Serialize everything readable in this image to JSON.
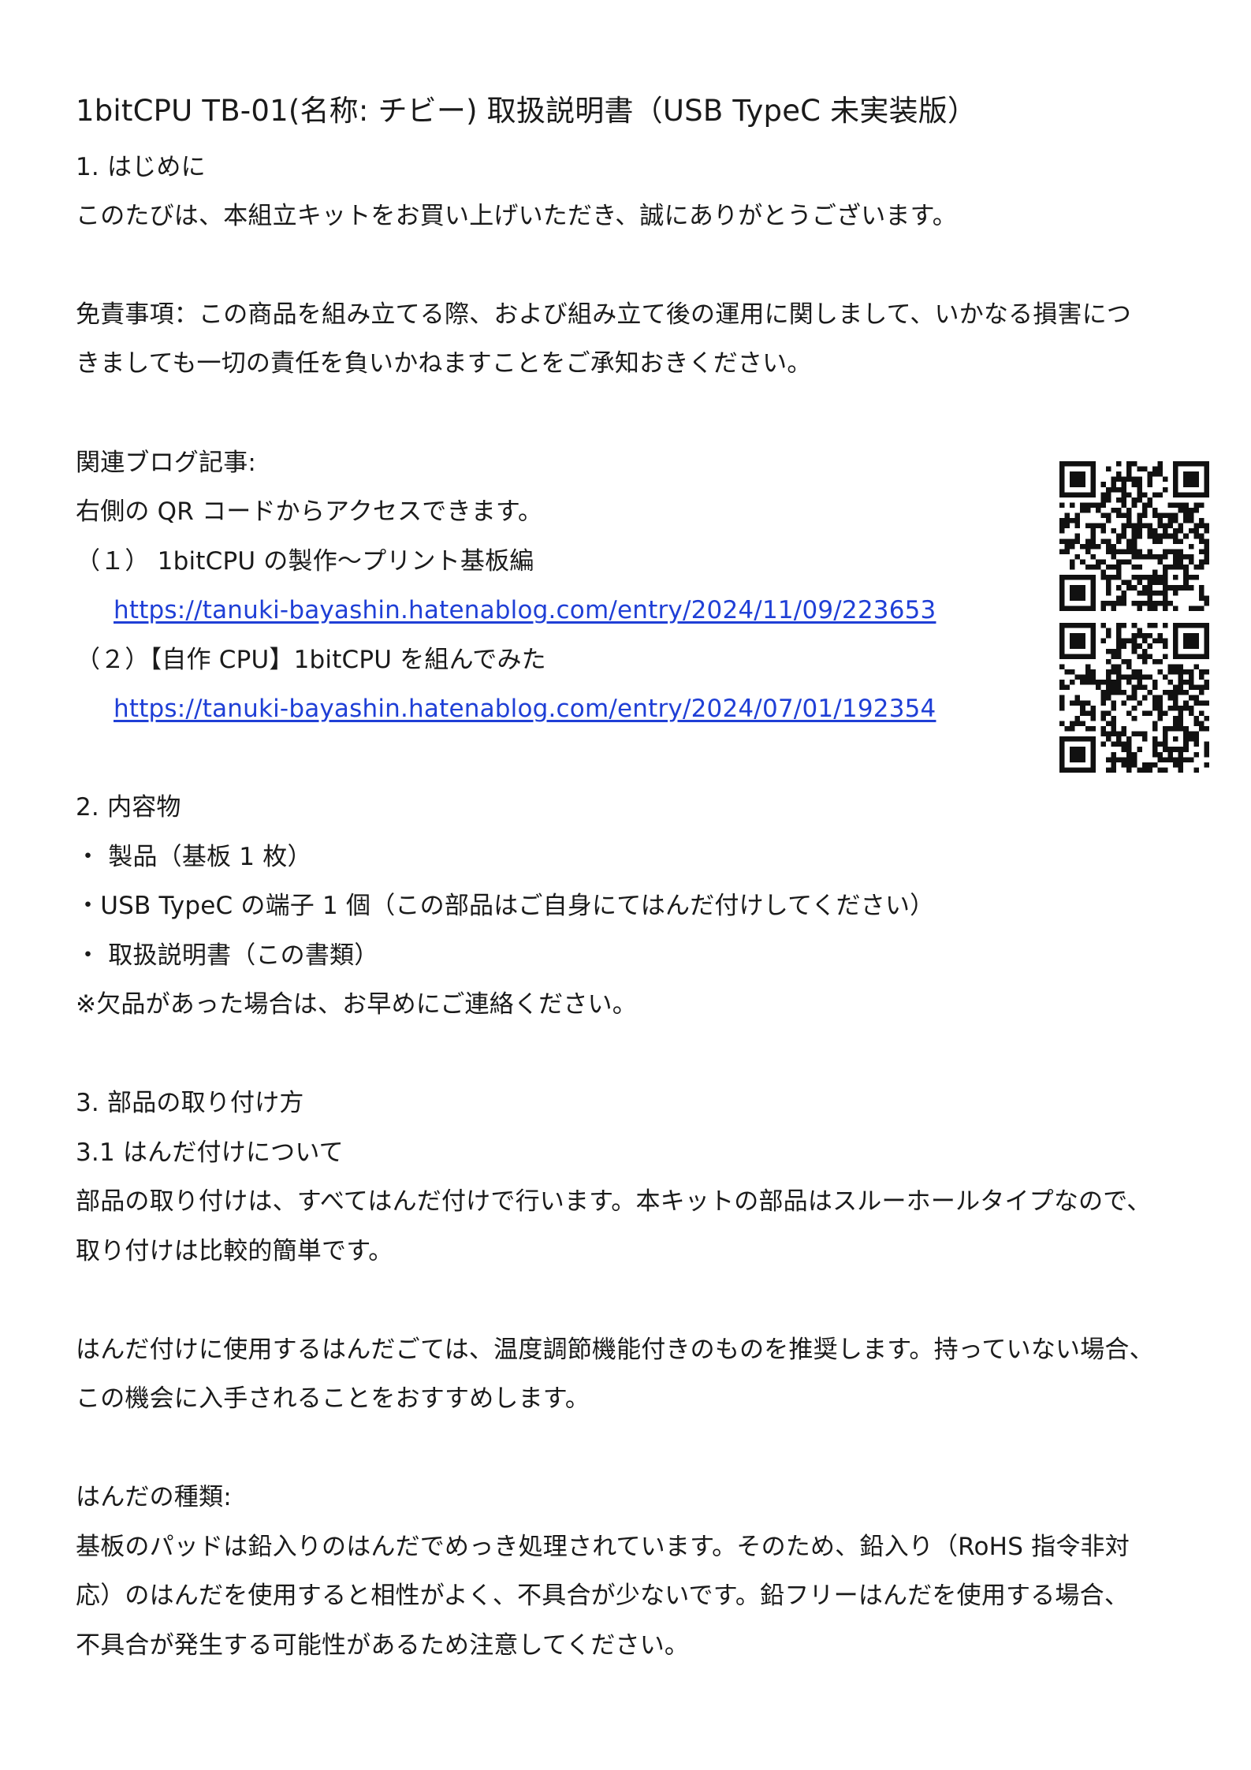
{
  "title": "1bitCPU TB-01(名称: チビー) 取扱説明書（USB TypeC 未実装版）",
  "sections": {
    "intro": {
      "heading": "1. はじめに",
      "line1": "このたびは、本組立キットをお買い上げいただき、誠にありがとうございます。"
    },
    "disclaimer": {
      "line1": "免責事項：この商品を組み立てる際、および組み立て後の運用に関しまして、いかなる損害につ",
      "line2": "きましても一切の責任を負いかねますことをご承知おきください。"
    },
    "blog": {
      "heading": "関連ブログ記事:",
      "line1": "右側の QR コードからアクセスできます。",
      "item1_label": "（１） 1bitCPU の製作～プリント基板編",
      "item1_url": "https://tanuki-bayashin.hatenablog.com/entry/2024/11/09/223653",
      "item2_label": "（２）【自作 CPU】1bitCPU を組んでみた",
      "item2_url": "https://tanuki-bayashin.hatenablog.com/entry/2024/07/01/192354"
    },
    "contents": {
      "heading": "2. 内容物",
      "item1": "・ 製品（基板 1 枚）",
      "item2": "・USB TypeC の端子 1 個（この部品はご自身にてはんだ付けしてください）",
      "item3": "・ 取扱説明書（この書類）",
      "note": "※欠品があった場合は、お早めにご連絡ください。"
    },
    "assembly": {
      "heading": "3. 部品の取り付け方",
      "sub_heading": "3.1 はんだ付けについて",
      "p1_line1": "部品の取り付けは、すべてはんだ付けで行います。本キットの部品はスルーホールタイプなので、",
      "p1_line2": "取り付けは比較的簡単です。",
      "p2_line1": "はんだ付けに使用するはんだごては、温度調節機能付きのものを推奨します。持っていない場合、",
      "p2_line2": "この機会に入手されることをおすすめします。",
      "solder_heading": "はんだの種類:",
      "p3_line1": "基板のパッドは鉛入りのはんだでめっき処理されています。そのため、鉛入り（RoHS 指令非対",
      "p3_line2": "応）のはんだを使用すると相性がよく、不具合が少ないです。鉛フリーはんだを使用する場合、",
      "p3_line3": "不具合が発生する可能性があるため注意してください。"
    }
  },
  "colors": {
    "text": "#1a1a1a",
    "link": "#1f3fd6"
  },
  "icons": {
    "qr1": "qr-code-icon",
    "qr2": "qr-code-icon"
  }
}
